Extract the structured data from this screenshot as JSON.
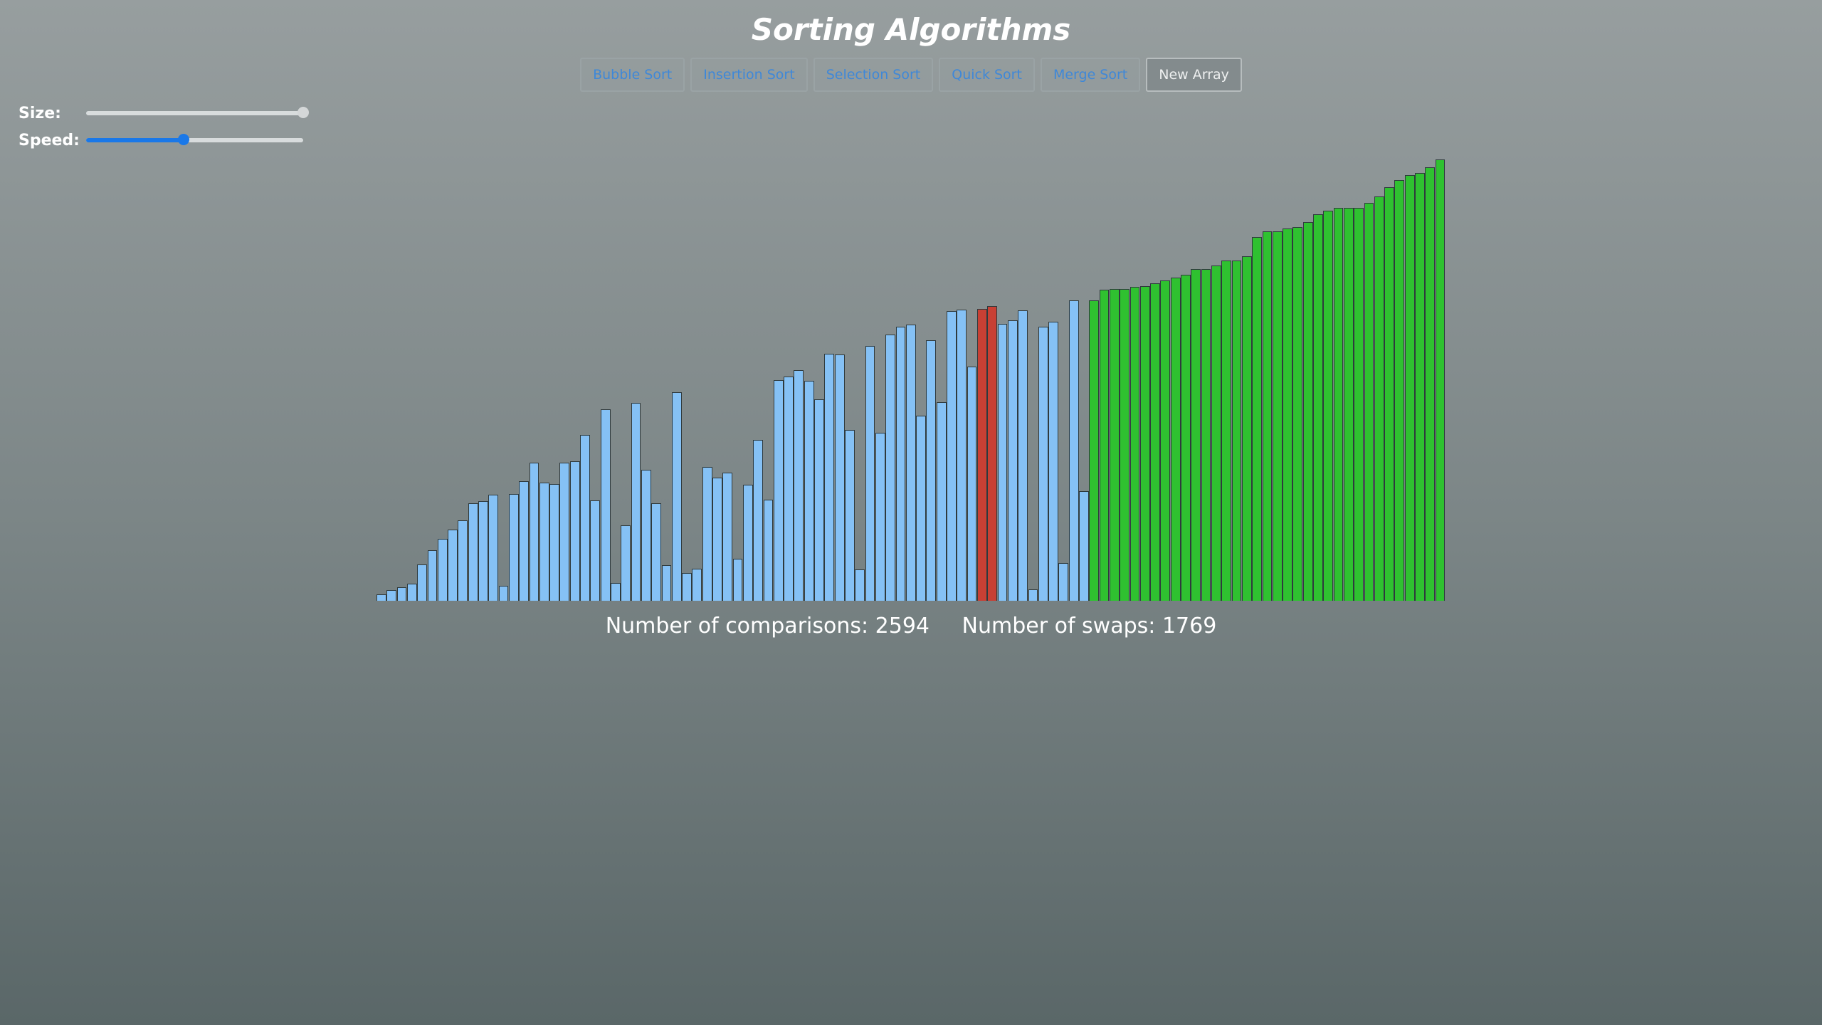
{
  "app": {
    "title": "Sorting Algorithms"
  },
  "toolbar": {
    "buttons": [
      {
        "label": "Bubble Sort"
      },
      {
        "label": "Insertion Sort"
      },
      {
        "label": "Selection Sort"
      },
      {
        "label": "Quick Sort"
      },
      {
        "label": "Merge Sort"
      },
      {
        "label": "New Array"
      }
    ]
  },
  "controls": {
    "size_label": "Size:",
    "size_value": 1.0,
    "speed_label": "Speed:",
    "speed_value": 0.45
  },
  "stats": {
    "comparisons_label": "Number of comparisons:",
    "comparisons_value": "2594",
    "swaps_label": "Number of swaps:",
    "swaps_value": "1769"
  },
  "colors": {
    "unsorted": "#85c1f5",
    "compare": "#c84034",
    "sorted": "#2fc130",
    "accent": "#1a78e8"
  },
  "array": {
    "values": [
      9,
      15,
      19,
      23,
      50,
      69,
      85,
      98,
      110,
      134,
      137,
      146,
      21,
      147,
      164,
      190,
      162,
      160,
      190,
      192,
      228,
      138,
      263,
      24,
      104,
      272,
      180,
      134,
      49,
      286,
      38,
      44,
      184,
      169,
      176,
      58,
      159,
      221,
      139,
      303,
      308,
      317,
      302,
      277,
      339,
      338,
      235,
      43,
      350,
      231,
      366,
      376,
      379,
      254,
      358,
      273,
      398,
      400,
      322,
      401,
      405,
      380,
      385,
      399,
      16,
      376,
      383,
      52,
      413,
      151,
      413,
      427,
      428,
      428,
      431,
      432,
      436,
      440,
      444,
      448,
      456,
      456,
      460,
      467,
      467,
      473,
      500,
      507,
      507,
      511,
      513,
      520,
      531,
      536,
      540,
      540,
      540,
      546,
      555,
      568,
      578,
      585,
      588,
      595,
      606
    ],
    "states": [
      "u",
      "u",
      "u",
      "u",
      "u",
      "u",
      "u",
      "u",
      "u",
      "u",
      "u",
      "u",
      "u",
      "u",
      "u",
      "u",
      "u",
      "u",
      "u",
      "u",
      "u",
      "u",
      "u",
      "u",
      "u",
      "u",
      "u",
      "u",
      "u",
      "u",
      "u",
      "u",
      "u",
      "u",
      "u",
      "u",
      "u",
      "u",
      "u",
      "u",
      "u",
      "u",
      "u",
      "u",
      "u",
      "u",
      "u",
      "u",
      "u",
      "u",
      "u",
      "u",
      "u",
      "u",
      "u",
      "u",
      "u",
      "u",
      "u",
      "c",
      "c",
      "u",
      "u",
      "u",
      "u",
      "u",
      "u",
      "u",
      "u",
      "u",
      "s",
      "s",
      "s",
      "s",
      "s",
      "s",
      "s",
      "s",
      "s",
      "s",
      "s",
      "s",
      "s",
      "s",
      "s",
      "s",
      "s",
      "s",
      "s",
      "s",
      "s",
      "s",
      "s",
      "s",
      "s",
      "s",
      "s",
      "s",
      "s",
      "s",
      "s",
      "s",
      "s",
      "s",
      "s"
    ]
  }
}
